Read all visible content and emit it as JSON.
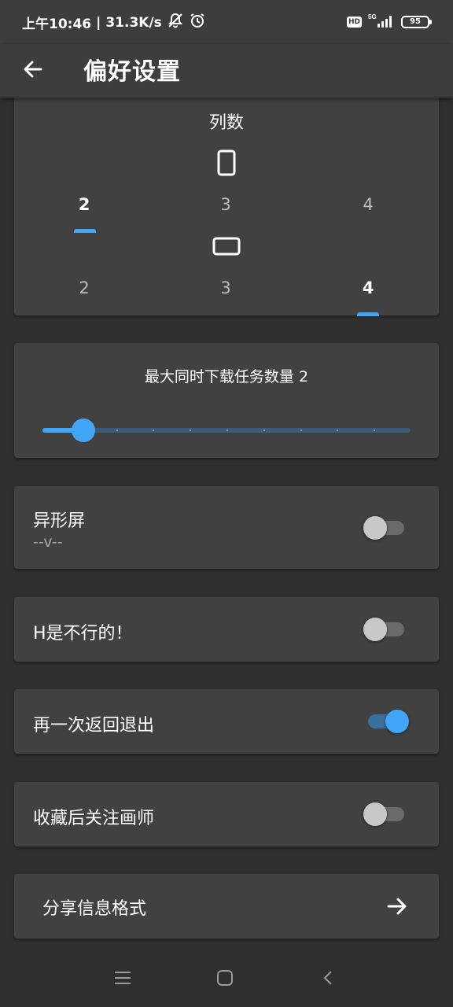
{
  "status_bar": {
    "time": "上午10:46",
    "separator": "|",
    "speed": "31.3K/s",
    "hd": "HD",
    "network": "5G",
    "battery": "95",
    "icons": [
      "muted-bell-icon",
      "alarm-icon",
      "signal-icon",
      "battery-icon"
    ]
  },
  "app_bar": {
    "title": "偏好设置",
    "back_icon": "arrow-left-icon"
  },
  "columns_card": {
    "title": "列数",
    "portrait": {
      "icon": "phone-portrait-icon",
      "options": [
        "2",
        "3",
        "4"
      ],
      "selected": "2"
    },
    "landscape": {
      "icon": "phone-landscape-icon",
      "options": [
        "2",
        "3",
        "4"
      ],
      "selected": "4"
    }
  },
  "download_card": {
    "title": "最大同时下载任务数量 2",
    "slider": {
      "min": 1,
      "max": 10,
      "value": 2,
      "steps": 10
    }
  },
  "toggles": [
    {
      "label": "异形屏",
      "sublabel": "--v--",
      "on": false
    },
    {
      "label": "H是不行的！",
      "on": false
    },
    {
      "label": "再一次返回退出",
      "on": true
    },
    {
      "label": "收藏后关注画师",
      "on": false
    }
  ],
  "share_card": {
    "label": "分享信息格式",
    "icon": "arrow-right-icon"
  },
  "nav_bar": {
    "icons": [
      "menu-icon",
      "home-icon",
      "back-icon"
    ]
  },
  "colors": {
    "accent": "#42a5f5",
    "background": "#2f2f2f",
    "card": "#414141",
    "appbar": "#3d3d3d"
  }
}
